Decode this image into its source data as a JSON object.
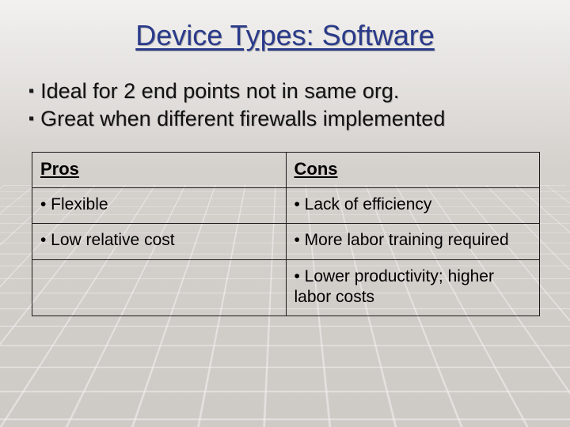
{
  "title": "Device Types: Software",
  "bullets": [
    "Ideal for 2 end points not in same org.",
    "Great when different firewalls implemented"
  ],
  "table": {
    "headers": {
      "pros": "Pros",
      "cons": "Cons"
    },
    "rows": [
      {
        "pro": "• Flexible",
        "con": "• Lack of efficiency"
      },
      {
        "pro": "• Low relative cost",
        "con": "• More labor training required"
      },
      {
        "pro": "",
        "con": "• Lower productivity; higher labor costs"
      }
    ]
  }
}
